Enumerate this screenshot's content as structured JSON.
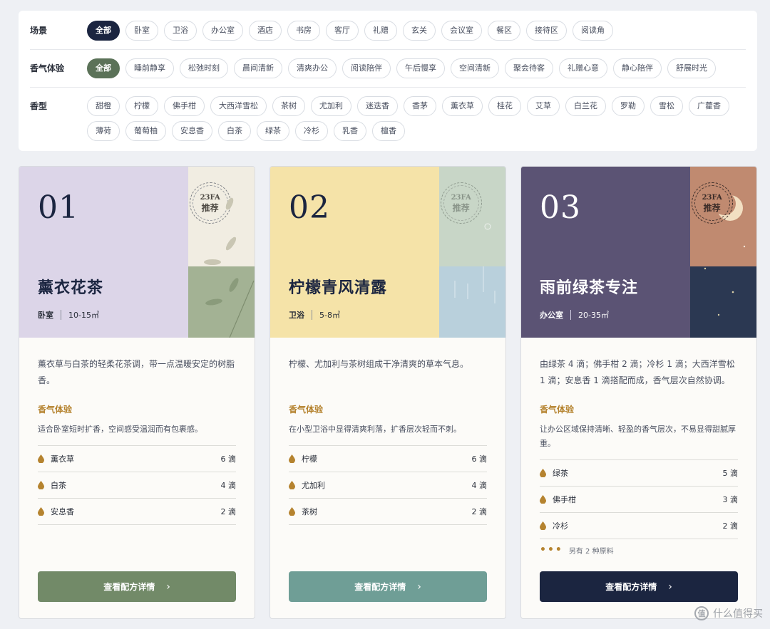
{
  "filters": {
    "scene": {
      "label": "场景",
      "options": [
        "全部",
        "卧室",
        "卫浴",
        "办公室",
        "酒店",
        "书房",
        "客厅",
        "礼赠",
        "玄关",
        "会议室",
        "餐区",
        "接待区",
        "阅读角"
      ]
    },
    "experience": {
      "label": "香气体验",
      "options": [
        "全部",
        "睡前静享",
        "松弛时刻",
        "晨间清新",
        "清爽办公",
        "阅读陪伴",
        "午后慢享",
        "空间清新",
        "聚会待客",
        "礼赠心意",
        "静心陪伴",
        "舒展时光"
      ]
    },
    "type": {
      "label": "香型",
      "options": [
        "甜橙",
        "柠檬",
        "佛手柑",
        "大西洋雪松",
        "茶树",
        "尤加利",
        "迷迭香",
        "香茅",
        "薰衣草",
        "桂花",
        "艾草",
        "白兰花",
        "罗勒",
        "雪松",
        "广藿香",
        "薄荷",
        "葡萄柚",
        "安息香",
        "白茶",
        "绿茶",
        "冷杉",
        "乳香",
        "檀香"
      ]
    }
  },
  "cards": [
    {
      "number": "01",
      "badge_top": "23FA",
      "badge_bottom": "推荐",
      "title": "薰衣花茶",
      "room": "卧室",
      "area": "10-15㎡",
      "description": "薰衣草与白茶的轻柔花茶调，带一点温暖安定的树脂香。",
      "experience_title": "香气体验",
      "experience_text": "适合卧室短时扩香，空间感受温润而有包裹感。",
      "ingredients": [
        {
          "name": "薰衣草",
          "qty": "6 滴"
        },
        {
          "name": "白茶",
          "qty": "4 滴"
        },
        {
          "name": "安息香",
          "qty": "2 滴"
        }
      ],
      "more": "",
      "button": "查看配方详情",
      "colors": {
        "main": "#dcd5e8",
        "side_upper": "#f1ede2",
        "side_lower": "#a3b294",
        "button": "#728a68"
      }
    },
    {
      "number": "02",
      "badge_top": "23FA",
      "badge_bottom": "推荐",
      "title": "柠檬青风清露",
      "room": "卫浴",
      "area": "5-8㎡",
      "description": "柠檬、尤加利与茶树组成干净清爽的草本气息。",
      "experience_title": "香气体验",
      "experience_text": "在小型卫浴中显得清爽利落，扩香层次轻而不刺。",
      "ingredients": [
        {
          "name": "柠檬",
          "qty": "6 滴"
        },
        {
          "name": "尤加利",
          "qty": "4 滴"
        },
        {
          "name": "茶树",
          "qty": "2 滴"
        }
      ],
      "more": "",
      "button": "查看配方详情",
      "colors": {
        "main": "#f5e3a8",
        "side_upper": "#c8d6c7",
        "side_lower": "#b9d0dc",
        "button": "#6f9e96"
      }
    },
    {
      "number": "03",
      "badge_top": "23FA",
      "badge_bottom": "推荐",
      "title": "雨前绿茶专注",
      "room": "办公室",
      "area": "20-35㎡",
      "description": "由绿茶 4 滴；佛手柑 2 滴；冷杉 1 滴；大西洋雪松 1 滴；安息香 1 滴搭配而成，香气层次自然协调。",
      "experience_title": "香气体验",
      "experience_text": "让办公区域保持清晰、轻盈的香气层次，不易显得甜腻厚重。",
      "ingredients": [
        {
          "name": "绿茶",
          "qty": "5 滴"
        },
        {
          "name": "佛手柑",
          "qty": "3 滴"
        },
        {
          "name": "冷杉",
          "qty": "2 滴"
        }
      ],
      "more": "另有 2 种原料",
      "button": "查看配方详情",
      "colors": {
        "main": "#5b5374",
        "side_upper": "#c08a70",
        "side_lower": "#2b3852",
        "button": "#1b2540"
      }
    }
  ],
  "watermark": {
    "text": "什么值得买",
    "logo": "值"
  }
}
